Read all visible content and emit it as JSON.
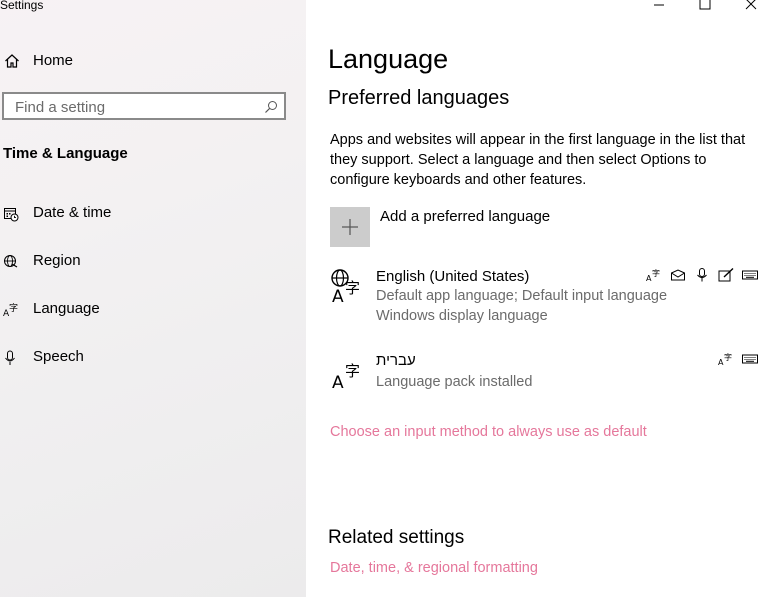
{
  "window": {
    "title": "Settings"
  },
  "sidebar": {
    "home_label": "Home",
    "search_placeholder": "Find a setting",
    "section_title": "Time & Language",
    "items": [
      {
        "label": "Date & time",
        "icon": "calendar-clock-icon"
      },
      {
        "label": "Region",
        "icon": "globe-icon"
      },
      {
        "label": "Language",
        "icon": "language-icon"
      },
      {
        "label": "Speech",
        "icon": "microphone-icon"
      }
    ]
  },
  "main": {
    "title": "Language",
    "preferred_heading": "Preferred languages",
    "description": "Apps and websites will appear in the first language in the list that they support. Select a language and then select Options to configure keyboards and other features.",
    "add_label": "Add a preferred language",
    "languages": [
      {
        "name": "English (United States)",
        "line1": "Default app language; Default input language",
        "line2": "Windows display language",
        "features": [
          "language-pack-icon",
          "text-to-speech-icon",
          "microphone-icon",
          "handwriting-icon",
          "keyboard-icon"
        ]
      },
      {
        "name": "עברית",
        "line1": "Language pack installed",
        "features": [
          "language-pack-icon",
          "keyboard-icon"
        ]
      }
    ],
    "input_method_link": "Choose an input method to always use as default",
    "related_heading": "Related settings",
    "related_link": "Date, time, & regional formatting"
  },
  "colors": {
    "accent_link": "#e5779b",
    "sidebar_bg": "#f1eff0",
    "add_button_bg": "#cccccc"
  }
}
